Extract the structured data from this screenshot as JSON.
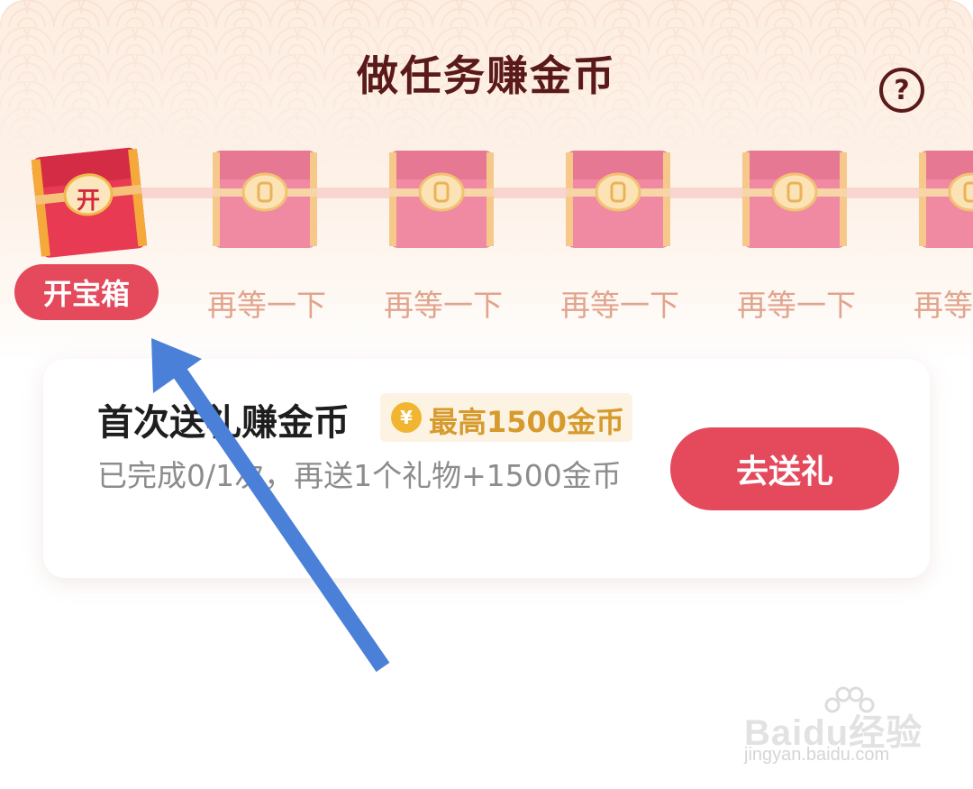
{
  "header": {
    "title": "做任务赚金币",
    "help_glyph": "?"
  },
  "chests": {
    "first": {
      "glyph": "开",
      "button_label": "开宝箱",
      "state": "ready"
    },
    "pending": [
      {
        "label": "再等一下"
      },
      {
        "label": "再等一下"
      },
      {
        "label": "再等一下"
      },
      {
        "label": "再等一下"
      },
      {
        "label": "再等一下"
      }
    ]
  },
  "task": {
    "title": "首次送礼赚金币",
    "reward": "最高1500金币",
    "coin_glyph": "¥",
    "desc": "已完成0/1次，再送1个礼物+1500金币",
    "button_label": "去送礼"
  },
  "watermark": {
    "brand": "Baidu经验",
    "url": "jingyan.baidu.com"
  },
  "colors": {
    "accent": "#e44a5c",
    "title": "#5a1a1a",
    "pending_label": "#e1a48d",
    "reward": "#d69a2d",
    "arrow": "#4a80d8"
  }
}
